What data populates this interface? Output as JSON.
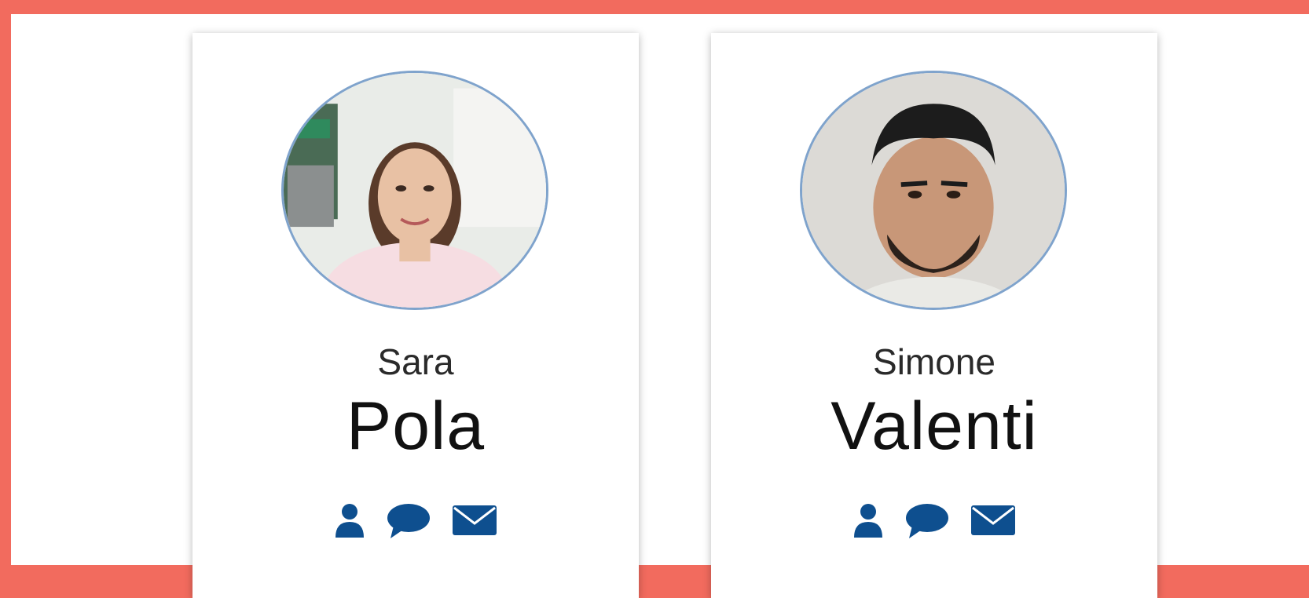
{
  "colors": {
    "background": "#f26b5e",
    "icon": "#0e4f8f",
    "avatar_border": "#7fa3cc"
  },
  "people": [
    {
      "first_name": "Sara",
      "last_name": "Pola",
      "actions": [
        "user-icon",
        "chat-bubble-icon",
        "envelope-icon"
      ]
    },
    {
      "first_name": "Simone",
      "last_name": "Valenti",
      "actions": [
        "user-icon",
        "chat-bubble-icon",
        "envelope-icon"
      ]
    }
  ]
}
